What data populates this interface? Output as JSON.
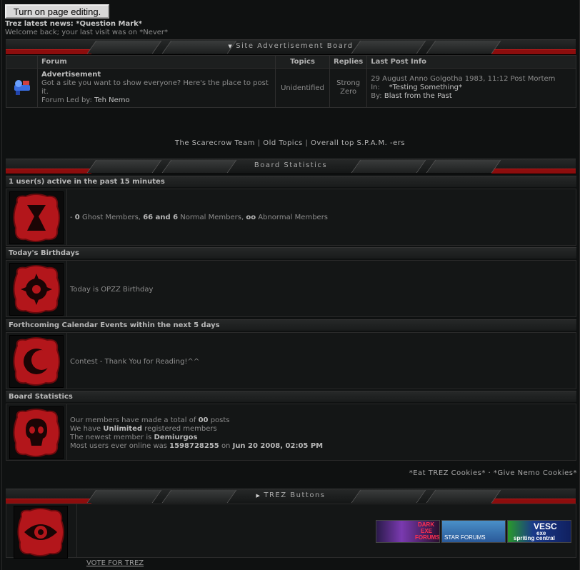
{
  "toolbar": {
    "edit_label": "Turn on page editing."
  },
  "news": {
    "label": "Trez latest news:",
    "value": "*Question Mark*"
  },
  "welcome": "Welcome back; your last visit was on *Never*",
  "ad_board": {
    "title": "Site Advertisement Board",
    "columns": [
      "Forum",
      "Topics",
      "Replies",
      "Last Post Info"
    ],
    "row": {
      "name": "Advertisement",
      "description": "Got a site you want to show everyone? Here's the place to post it.",
      "leader_label": "Forum Led by:",
      "leader": "Teh Nemo",
      "topics": "Unidentified",
      "replies_1": "Strong",
      "replies_2": "Zero",
      "last_date": "29 August Anno Golgotha 1983, 11:12 Post Mortem",
      "last_in_label": "In:",
      "last_in": "*Testing Something*",
      "last_by_label": "By:",
      "last_by": "Blast from the Past"
    }
  },
  "links": {
    "team": "The Scarecrow Team",
    "old": "Old Topics",
    "top": "Overall top S.P.A.M. -ers",
    "sep": "|"
  },
  "stats": {
    "title": "Board Statistics",
    "active": {
      "header": "1 user(s) active in the past 15 minutes",
      "ghost": "0",
      "ghost_label": "Ghost Members,",
      "normal": "66 and 6",
      "normal_label": "Normal Members,",
      "abnormal": "oo",
      "abnormal_label": "Abnormal Members",
      "prefix": "-"
    },
    "birthdays": {
      "header": "Today's Birthdays",
      "text": "Today is OPZZ Birthday"
    },
    "calendar": {
      "header": "Forthcoming Calendar Events within the next 5 days",
      "text": "Contest - Thank You for Reading!^^"
    },
    "board": {
      "header": "Board Statistics",
      "line1_pre": "Our members have made a total of",
      "posts": "00",
      "line1_post": "posts",
      "line2_pre": "We have",
      "registered": "Unlimited",
      "line2_post": "registered members",
      "line3_pre": "The newest member is",
      "newest": "Demiurgos",
      "line4_pre": "Most users ever online was",
      "most": "1598728255",
      "line4_mid": "on",
      "most_date": "Jun 20 2008, 02:05 PM"
    }
  },
  "cookies": {
    "eat": "*Eat TREZ Cookies*",
    "sep": "·",
    "give": "*Give Nemo Cookies*"
  },
  "buttons_section": {
    "title": "TREZ Buttons",
    "banners": [
      {
        "l1": "DARK",
        "l2": "EXE",
        "l3": "FORUMS"
      },
      {
        "l1": "STAR FORUMS"
      },
      {
        "l1": "VESC",
        "l2": "exe",
        "l3": "spriting central"
      }
    ]
  },
  "vote": "VOTE FOR TREZ",
  "colors": {
    "accent_red": "#8c0d0d",
    "seal_red": "#b3161b",
    "background": "#0f1111"
  }
}
